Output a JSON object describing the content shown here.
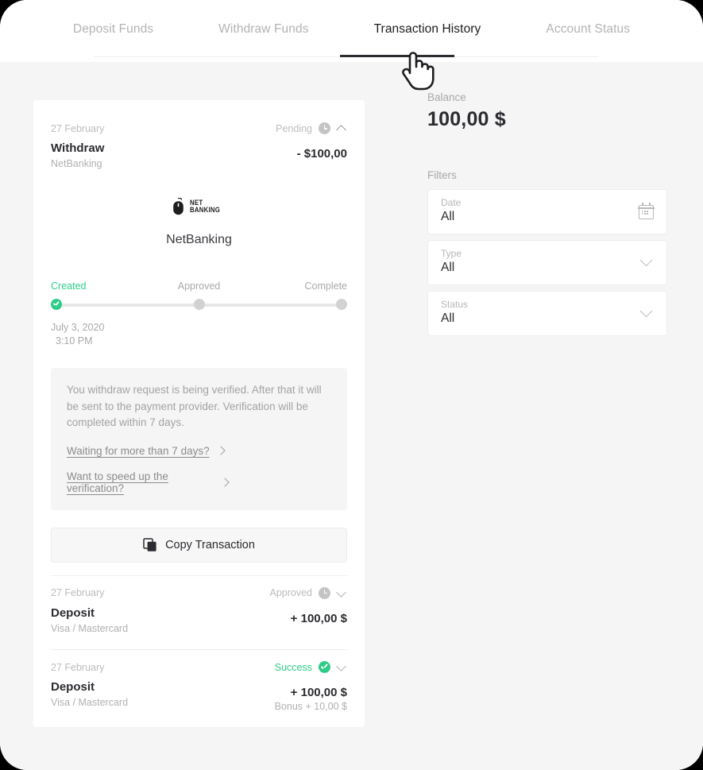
{
  "tabs": [
    {
      "label": "Deposit Funds",
      "active": false
    },
    {
      "label": "Withdraw Funds",
      "active": false
    },
    {
      "label": "Transaction History",
      "active": true
    },
    {
      "label": "Account Status",
      "active": false
    }
  ],
  "expanded_transaction": {
    "date": "27 February",
    "status": "Pending",
    "status_icon": "clock-icon",
    "toggle_icon": "chevron-up-icon",
    "title": "Withdraw",
    "method": "NetBanking",
    "amount": "- $100,00",
    "brand_logo_text_line1": "NET",
    "brand_logo_text_line2": "BANKING",
    "brand_name": "NetBanking",
    "steps": [
      {
        "label": "Created",
        "state": "done"
      },
      {
        "label": "Approved",
        "state": "pending"
      },
      {
        "label": "Complete",
        "state": "pending"
      }
    ],
    "step_date": "July 3, 2020",
    "step_time": "3:10 PM",
    "notice_text": "You withdraw request is being verified. After that it will be sent to the payment provider. Verification will be completed within 7 days.",
    "notice_links": [
      {
        "label": "Waiting for more than 7 days?",
        "icon": "chevron-right-icon"
      },
      {
        "label": "Want to speed up the verification?",
        "icon": "chevron-right-icon"
      }
    ],
    "copy_button": {
      "label": "Copy Transaction",
      "icon": "copy-icon"
    }
  },
  "transactions": [
    {
      "date": "27 February",
      "status": "Approved",
      "status_icon": "clock-icon",
      "status_color": "#bcbcbc",
      "toggle_icon": "chevron-down-icon",
      "title": "Deposit",
      "method": "Visa / Mastercard",
      "amount": "+ 100,00 $",
      "bonus": ""
    },
    {
      "date": "27 February",
      "status": "Success",
      "status_icon": "check-circle-icon",
      "status_color": "#2ecc87",
      "toggle_icon": "chevron-down-icon",
      "title": "Deposit",
      "method": "Visa / Mastercard",
      "amount": "+ 100,00 $",
      "bonus": "Bonus + 10,00 $"
    }
  ],
  "sidebar": {
    "balance_label": "Balance",
    "balance_value": "100,00 $",
    "filters_label": "Filters",
    "filters": [
      {
        "name": "Date",
        "value": "All",
        "icon": "calendar-icon"
      },
      {
        "name": "Type",
        "value": "All",
        "icon": "chevron-down-icon"
      },
      {
        "name": "Status",
        "value": "All",
        "icon": "chevron-down-icon"
      }
    ]
  },
  "cursor": {
    "icon": "pointing-hand-cursor"
  },
  "colors": {
    "accent_green": "#2ecc87",
    "text_dark": "#2b2b30",
    "text_muted": "#b0b0b0",
    "page_bg": "#f5f5f5"
  }
}
